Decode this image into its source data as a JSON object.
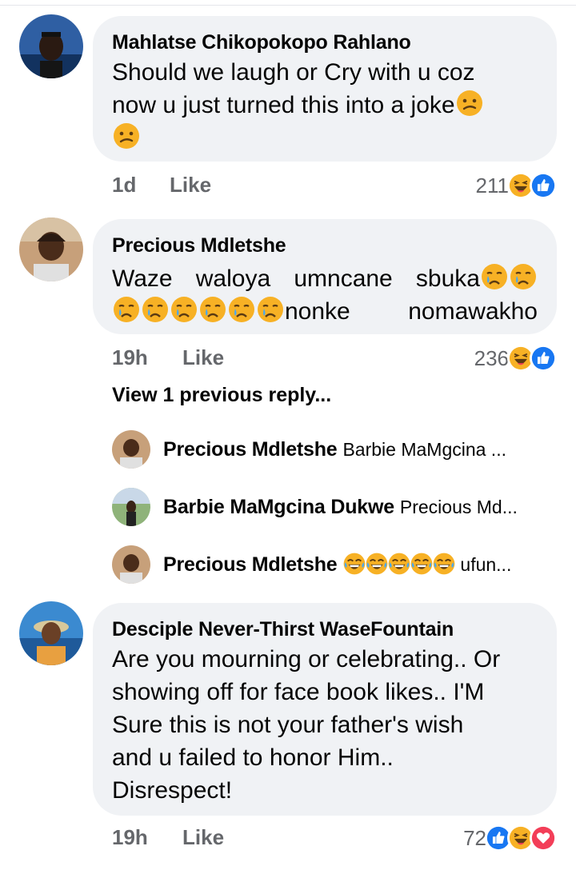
{
  "comments": [
    {
      "author": "Mahlatse Chikopokopo Rahlano",
      "text_line1": "Should we laugh or Cry with u coz",
      "text_line2": "now u just turned this into a joke",
      "time": "1d",
      "like_label": "Like",
      "reaction_count": "211",
      "reactions": [
        "haha-icon",
        "like-icon"
      ]
    },
    {
      "author": "Precious Mdletshe",
      "text_line1": "Waze waloya umncane sbuka",
      "text_line2_suffix": "nonke nomawakho",
      "time": "19h",
      "like_label": "Like",
      "reaction_count": "236",
      "reactions": [
        "haha-icon",
        "like-icon"
      ],
      "view_previous": "View 1 previous reply...",
      "replies": [
        {
          "name": "Precious Mdletshe",
          "text": "Barbie MaMgcina ..."
        },
        {
          "name": "Barbie MaMgcina Dukwe",
          "text": "Precious Md..."
        },
        {
          "name": "Precious Mdletshe",
          "text": "ufun..."
        }
      ]
    },
    {
      "author": "Desciple Never-Thirst WaseFountain",
      "text_lines": [
        "Are you mourning or celebrating.. Or",
        "showing off for face book likes.. I'M",
        "Sure this is not your father's wish",
        "and u failed to honor Him..",
        "Disrespect!"
      ],
      "time": "19h",
      "like_label": "Like",
      "reaction_count": "72",
      "reactions": [
        "like-icon",
        "haha-icon",
        "love-icon"
      ]
    }
  ],
  "colors": {
    "bubble": "#f0f2f5",
    "meta_text": "#65676b",
    "like_blue": "#1877f2",
    "love_red": "#f33e58",
    "emoji_yellow": "#f7b125"
  }
}
